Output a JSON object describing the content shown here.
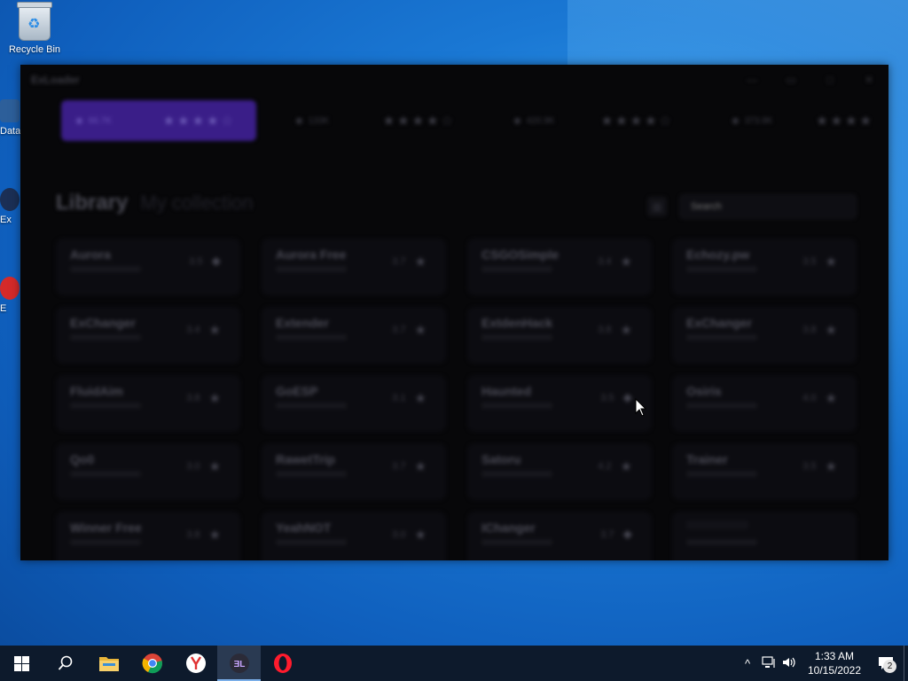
{
  "desktop": {
    "icons": [
      {
        "label": "Recycle Bin",
        "icon": "recycle-bin-icon"
      },
      {
        "label": "Data",
        "icon": "shortcut-icon"
      },
      {
        "label": "Ex",
        "icon": "shortcut-icon"
      },
      {
        "label": "E",
        "icon": "shortcut-icon"
      }
    ]
  },
  "app": {
    "title": "ExLoader",
    "window_controls": {
      "minimize": "—",
      "restore": "▭",
      "maximize": "□",
      "close": "✕"
    },
    "featured": [
      {
        "views": "66.7K",
        "stars": "★★★★☆",
        "active": true
      },
      {
        "views": "133K",
        "stars": "★★★★☆",
        "active": false
      },
      {
        "views": "420.9K",
        "stars": "★★★★☆",
        "active": false
      },
      {
        "views": "373.8K",
        "stars": "★★★★",
        "active": false
      }
    ],
    "library": {
      "title": "Library",
      "subtitle": "My collection",
      "search_placeholder": "Search",
      "items": [
        {
          "name": "Aurora",
          "rating": "3.5",
          "icon": "tag-icon"
        },
        {
          "name": "Aurora Free",
          "rating": "3.7",
          "icon": "star-icon"
        },
        {
          "name": "CSGOSimple",
          "rating": "3.4",
          "icon": "star-icon"
        },
        {
          "name": "Echozy.pw",
          "rating": "3.5",
          "icon": "star-icon"
        },
        {
          "name": "ExChanger",
          "rating": "3.4",
          "icon": "star-icon"
        },
        {
          "name": "Extender",
          "rating": "3.7",
          "icon": "star-icon"
        },
        {
          "name": "ExtdenHack",
          "rating": "3.8",
          "icon": "star-icon"
        },
        {
          "name": "ExChanger",
          "rating": "3.8",
          "icon": "star-icon"
        },
        {
          "name": "FluidAim",
          "rating": "3.8",
          "icon": "star-icon"
        },
        {
          "name": "GoESP",
          "rating": "3.1",
          "icon": "star-icon"
        },
        {
          "name": "Haunted",
          "rating": "3.5",
          "icon": "tag-icon"
        },
        {
          "name": "Osiris",
          "rating": "4.0",
          "icon": "star-icon"
        },
        {
          "name": "Qo0",
          "rating": "3.0",
          "icon": "star-icon"
        },
        {
          "name": "RawetTrip",
          "rating": "3.7",
          "icon": "star-icon"
        },
        {
          "name": "Satoru",
          "rating": "4.2",
          "icon": "star-icon"
        },
        {
          "name": "Trainer",
          "rating": "3.5",
          "icon": "star-icon"
        },
        {
          "name": "Winner Free",
          "rating": "3.8",
          "icon": "star-icon"
        },
        {
          "name": "YeahNOT",
          "rating": "3.0",
          "icon": "star-icon"
        },
        {
          "name": "IChanger",
          "rating": "3.7",
          "icon": "tag-icon"
        },
        {
          "name": "",
          "rating": "",
          "icon": ""
        }
      ]
    }
  },
  "taskbar": {
    "apps": [
      {
        "name": "start-button",
        "icon": "windows-logo-icon"
      },
      {
        "name": "search-button",
        "icon": "search-icon"
      },
      {
        "name": "file-explorer",
        "icon": "folder-icon"
      },
      {
        "name": "chrome",
        "icon": "chrome-icon"
      },
      {
        "name": "yandex",
        "icon": "yandex-icon"
      },
      {
        "name": "exloader",
        "icon": "exloader-icon"
      },
      {
        "name": "opera",
        "icon": "opera-icon"
      }
    ],
    "tray": {
      "chevron": "^",
      "time": "1:33 AM",
      "date": "10/15/2022",
      "notification_count": "2"
    }
  },
  "colors": {
    "accent_purple": "#3a1e88",
    "app_bg": "#070709",
    "taskbar_bg": "#0d1a2c"
  }
}
